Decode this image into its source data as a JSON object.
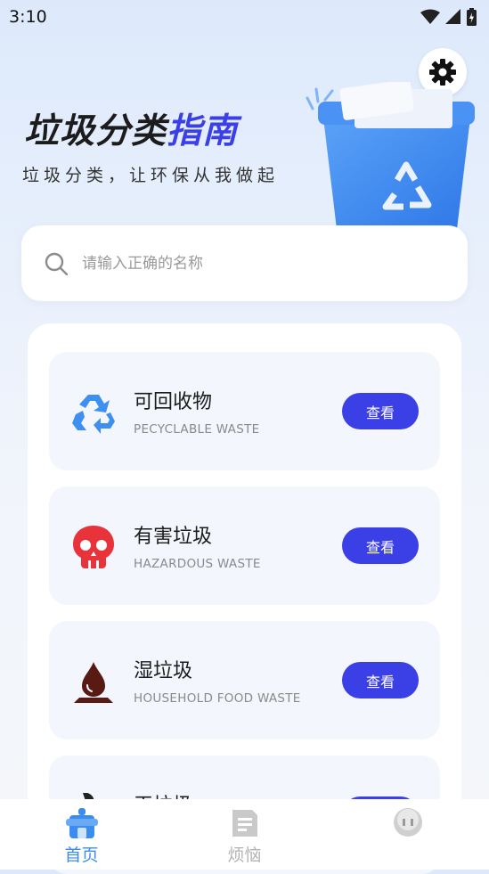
{
  "status": {
    "time": "3:10"
  },
  "hero": {
    "title_main": "垃圾分类",
    "title_accent": "指南",
    "subtitle": "垃圾分类，让环保从我做起"
  },
  "search": {
    "placeholder": "请输入正确的名称"
  },
  "categories": [
    {
      "title": "可回收物",
      "subtitle": "PECYCLABLE WASTE",
      "button": "查看",
      "icon": "recycle-icon",
      "color": "#3d8ff0"
    },
    {
      "title": "有害垃圾",
      "subtitle": "HAZARDOUS WASTE",
      "button": "查看",
      "icon": "skull-icon",
      "color": "#e8333a"
    },
    {
      "title": "湿垃圾",
      "subtitle": "HOUSEHOLD FOOD WASTE",
      "button": "查看",
      "icon": "droplet-icon",
      "color": "#5a1a14"
    },
    {
      "title": "干垃圾",
      "subtitle": "",
      "button": "查看",
      "icon": "dry-waste-icon",
      "color": "#222222"
    }
  ],
  "tabs": [
    {
      "label": "首页",
      "icon": "home-icon",
      "active": true
    },
    {
      "label": "烦恼",
      "icon": "document-icon",
      "active": false
    },
    {
      "label": "",
      "icon": "profile-icon",
      "active": false
    }
  ],
  "colors": {
    "accent": "#3b3fe6",
    "tab_active": "#3b8cf0",
    "tab_inactive": "#b3b3b3"
  }
}
